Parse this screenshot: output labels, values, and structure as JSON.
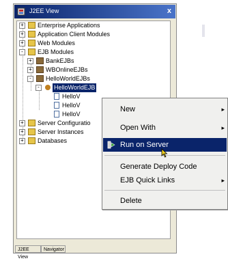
{
  "window": {
    "title": "J2EE View",
    "close_glyph": "x"
  },
  "tree": {
    "nodes": [
      {
        "label": "Enterprise Applications",
        "icon": "folder-icon",
        "expander": "+"
      },
      {
        "label": "Application Client Modules",
        "icon": "folder-icon",
        "expander": "+"
      },
      {
        "label": "Web Modules",
        "icon": "folder-icon",
        "expander": "+"
      },
      {
        "label": "EJB Modules",
        "icon": "folder-icon",
        "expander": "-"
      },
      {
        "label": "BankEJBs",
        "icon": "jar-icon",
        "expander": "+"
      },
      {
        "label": "WBOnlineEJBs",
        "icon": "jar-icon",
        "expander": "+"
      },
      {
        "label": "HelloWorldEJBs",
        "icon": "jar-icon",
        "expander": "-"
      },
      {
        "label": "HelloWorldEJB",
        "icon": "bean-icon",
        "expander": "-"
      },
      {
        "label": "HelloV",
        "icon": "file-icon",
        "expander": ""
      },
      {
        "label": "HelloV",
        "icon": "file-icon",
        "expander": ""
      },
      {
        "label": "HelloV",
        "icon": "file-icon",
        "expander": ""
      },
      {
        "label": "Server Configuratio",
        "icon": "folder-icon",
        "expander": "+"
      },
      {
        "label": "Server Instances",
        "icon": "folder-icon",
        "expander": "+"
      },
      {
        "label": "Databases",
        "icon": "folder-icon",
        "expander": "+"
      }
    ]
  },
  "tabs": [
    {
      "label": "J2EE View"
    },
    {
      "label": "Navigator"
    }
  ],
  "context_menu": {
    "items": [
      {
        "label": "New",
        "submenu": true
      },
      {
        "label": "Open With",
        "submenu": true
      },
      {
        "label": "Run on Server",
        "submenu": false,
        "highlighted": true
      },
      {
        "label": "Generate Deploy Code",
        "submenu": false
      },
      {
        "label": "EJB Quick Links",
        "submenu": true
      },
      {
        "label": "Delete",
        "submenu": false
      }
    ],
    "submenu_arrow": "▸"
  },
  "colors": {
    "selection": "#0a246a",
    "folder": "#e6c54a",
    "window_bg": "#ece9d8"
  }
}
